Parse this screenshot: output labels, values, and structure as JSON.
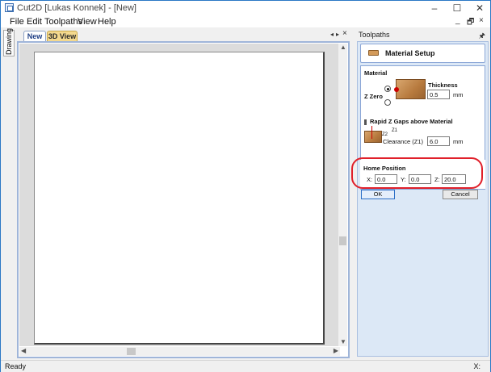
{
  "window": {
    "title": "Cut2D [Lukas Konnek] - [New]",
    "minimize": "–",
    "maximize": "☐",
    "close": "✕"
  },
  "menu": {
    "items": [
      "File",
      "Edit",
      "Toolpaths",
      "View",
      "Help"
    ],
    "mdi_minimize": "_",
    "mdi_restore": "🗗",
    "mdi_close": "×"
  },
  "side_tab": {
    "label": "Drawing"
  },
  "doc": {
    "tabs": [
      "New",
      "3D View"
    ],
    "active_tab": "New",
    "nav_prev": "◂",
    "nav_next": "▸",
    "nav_close": "×"
  },
  "panel": {
    "title": "Toolpaths",
    "pin": "🖈",
    "header": "Material Setup",
    "material": {
      "section_label": "Material",
      "z_zero_label": "Z Zero",
      "thickness_label": "Thickness",
      "thickness_value": "0.5",
      "unit": "mm"
    },
    "rapid": {
      "section_label": "Rapid Z Gaps above Material",
      "z1_tag": "Z1",
      "z2_tag": "Z2",
      "clearance_label": "Clearance (Z1)",
      "clearance_value": "6.0",
      "unit": "mm"
    },
    "home": {
      "section_label": "Home Position",
      "x_label": "X:",
      "x_value": "0.0",
      "y_label": "Y:",
      "y_value": "0.0",
      "z_label": "Z:",
      "z_value": "20.0"
    },
    "ok_label": "OK",
    "cancel_label": "Cancel"
  },
  "status": {
    "text": "Ready",
    "coord": "X:"
  },
  "colors": {
    "highlight_ellipse": "#e0202a",
    "panel_bg": "#dce8f6",
    "window_border": "#2b78c5"
  }
}
